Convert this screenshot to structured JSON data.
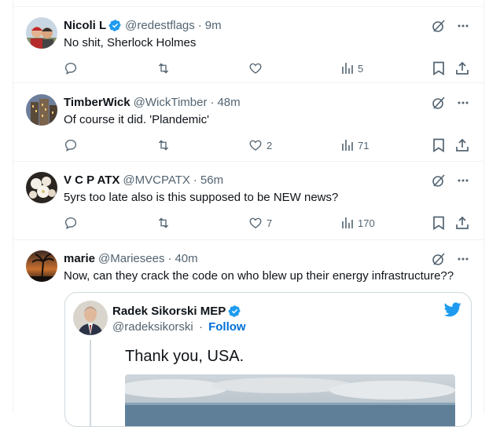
{
  "colors": {
    "accent": "#1d9bf0",
    "muted": "#536471",
    "text": "#0f1419",
    "border": "#eff3f4"
  },
  "tweets": [
    {
      "name": "Nicoli L",
      "handle": "@redestflags",
      "time": "9m",
      "verified": true,
      "text": "No shit, Sherlock Holmes",
      "likes": "",
      "views": "5",
      "avatar_icon": "avatar-photo-people"
    },
    {
      "name": "TimberWick",
      "handle": "@WickTimber",
      "time": "48m",
      "verified": false,
      "text": "Of course it did. 'Plandemic'",
      "likes": "2",
      "views": "71",
      "avatar_icon": "avatar-photo-building"
    },
    {
      "name": "V C P ATX",
      "handle": "@MVCPATX",
      "time": "56m",
      "verified": false,
      "text": "5yrs too late also is this supposed to be NEW news?",
      "likes": "7",
      "views": "170",
      "avatar_icon": "avatar-photo-flowers"
    },
    {
      "name": "marie",
      "handle": "@Mariesees",
      "time": "40m",
      "verified": false,
      "text": "Now, can they crack the code on who blew up their energy infrastructure??",
      "avatar_icon": "avatar-photo-palm"
    }
  ],
  "quote": {
    "name": "Radek Sikorski MEP",
    "handle": "@radeksikorski",
    "follow_label": "Follow",
    "text": "Thank you, USA.",
    "platform_icon": "bird-icon"
  },
  "separator": "·"
}
